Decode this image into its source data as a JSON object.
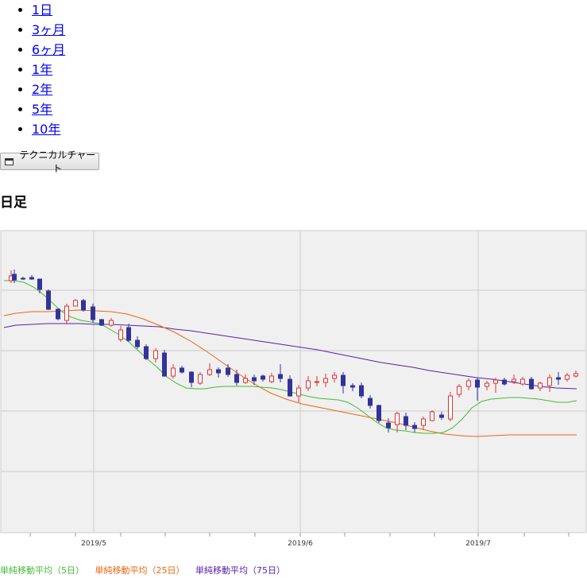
{
  "periods": [
    "1日",
    "3ヶ月",
    "6ヶ月",
    "1年",
    "2年",
    "5年",
    "10年"
  ],
  "tech_button_label": "テクニカルチャート",
  "title": "日足",
  "chart_data": {
    "type": "candlestick",
    "x_tick_labels": [
      "2019/5",
      "2019/6",
      "2019/7"
    ],
    "legend": [
      {
        "label": "単純移動平均（5日）",
        "color": "#44bb33"
      },
      {
        "label": "単純移動平均（25日）",
        "color": "#ee6611"
      },
      {
        "label": "単純移動平均（75日）",
        "color": "#5522aa"
      }
    ],
    "up_color": "#dd3333",
    "down_color": "#333399",
    "candles": [
      [
        14,
        65,
        59,
        68,
        52
      ],
      [
        18,
        57,
        64,
        68,
        51
      ],
      [
        29,
        62,
        63,
        64,
        60
      ],
      [
        40,
        61,
        63,
        64,
        58
      ],
      [
        50,
        63,
        76,
        81,
        63
      ],
      [
        61,
        78,
        101,
        102,
        76
      ],
      [
        73,
        101,
        113,
        115,
        100
      ],
      [
        84,
        115,
        97,
        120,
        94
      ],
      [
        95,
        97,
        90,
        96,
        88
      ],
      [
        105,
        90,
        102,
        104,
        88
      ],
      [
        117,
        98,
        114,
        118,
        94
      ],
      [
        128,
        114,
        121,
        122,
        113
      ],
      [
        140,
        121,
        115,
        123,
        112
      ],
      [
        152,
        139,
        127,
        142,
        122
      ],
      [
        162,
        124,
        140,
        142,
        119
      ],
      [
        173,
        140,
        148,
        151,
        135
      ],
      [
        184,
        148,
        163,
        165,
        145
      ],
      [
        196,
        163,
        153,
        168,
        150
      ],
      [
        207,
        156,
        185,
        186,
        152
      ],
      [
        218,
        185,
        175,
        188,
        170
      ],
      [
        229,
        175,
        180,
        182,
        172
      ],
      [
        241,
        180,
        193,
        199,
        179
      ],
      [
        252,
        194,
        183,
        196,
        180
      ],
      [
        264,
        183,
        177,
        185,
        169
      ],
      [
        275,
        177,
        181,
        187,
        174
      ],
      [
        287,
        175,
        183,
        186,
        170
      ],
      [
        298,
        183,
        193,
        197,
        177
      ],
      [
        309,
        193,
        188,
        195,
        183
      ],
      [
        320,
        187,
        191,
        196,
        183
      ],
      [
        331,
        185,
        189,
        192,
        183
      ],
      [
        342,
        192,
        185,
        194,
        181
      ],
      [
        353,
        183,
        188,
        193,
        170
      ],
      [
        365,
        189,
        210,
        211,
        184
      ],
      [
        376,
        210,
        200,
        218,
        196
      ],
      [
        388,
        200,
        191,
        204,
        185
      ],
      [
        399,
        193,
        192,
        198,
        185
      ],
      [
        410,
        193,
        188,
        199,
        182
      ],
      [
        421,
        188,
        184,
        193,
        180
      ],
      [
        432,
        184,
        197,
        207,
        180
      ],
      [
        444,
        197,
        199,
        204,
        194
      ],
      [
        455,
        197,
        210,
        213,
        193
      ],
      [
        466,
        213,
        222,
        226,
        209
      ],
      [
        477,
        222,
        241,
        244,
        221
      ],
      [
        489,
        244,
        250,
        256,
        238
      ],
      [
        500,
        246,
        232,
        256,
        230
      ],
      [
        511,
        236,
        247,
        253,
        231
      ],
      [
        522,
        247,
        251,
        256,
        243
      ],
      [
        533,
        247,
        239,
        252,
        236
      ],
      [
        544,
        241,
        230,
        242,
        228
      ],
      [
        556,
        234,
        237,
        240,
        230
      ],
      [
        567,
        239,
        210,
        242,
        205
      ],
      [
        578,
        208,
        198,
        212,
        195
      ],
      [
        590,
        198,
        191,
        203,
        188
      ],
      [
        601,
        190,
        199,
        216,
        187
      ],
      [
        613,
        198,
        194,
        203,
        191
      ],
      [
        624,
        194,
        190,
        206,
        187
      ],
      [
        635,
        190,
        195,
        197,
        187
      ],
      [
        647,
        192,
        189,
        195,
        183
      ],
      [
        658,
        195,
        189,
        197,
        186
      ],
      [
        669,
        189,
        201,
        202,
        186
      ],
      [
        680,
        200,
        194,
        204,
        192
      ],
      [
        692,
        197,
        187,
        205,
        183
      ],
      [
        703,
        187,
        189,
        196,
        180
      ],
      [
        714,
        189,
        184,
        192,
        181
      ],
      [
        725,
        185,
        182,
        187,
        178
      ]
    ],
    "ma5": [
      [
        5,
        65
      ],
      [
        18,
        65
      ],
      [
        30,
        67
      ],
      [
        42,
        73
      ],
      [
        54,
        82
      ],
      [
        66,
        93
      ],
      [
        78,
        104
      ],
      [
        90,
        111
      ],
      [
        102,
        115
      ],
      [
        114,
        117
      ],
      [
        126,
        119
      ],
      [
        138,
        126
      ],
      [
        150,
        133
      ],
      [
        162,
        142
      ],
      [
        174,
        153
      ],
      [
        186,
        164
      ],
      [
        198,
        174
      ],
      [
        210,
        186
      ],
      [
        222,
        194
      ],
      [
        234,
        200
      ],
      [
        246,
        201
      ],
      [
        258,
        201
      ],
      [
        270,
        199
      ],
      [
        282,
        198
      ],
      [
        294,
        198
      ],
      [
        306,
        198
      ],
      [
        318,
        198
      ],
      [
        330,
        199
      ],
      [
        342,
        200
      ],
      [
        354,
        202
      ],
      [
        366,
        205
      ],
      [
        378,
        208
      ],
      [
        390,
        211
      ],
      [
        402,
        213
      ],
      [
        414,
        214
      ],
      [
        426,
        215
      ],
      [
        438,
        218
      ],
      [
        450,
        225
      ],
      [
        462,
        234
      ],
      [
        474,
        243
      ],
      [
        486,
        250
      ],
      [
        498,
        253
      ],
      [
        510,
        254
      ],
      [
        522,
        256
      ],
      [
        534,
        257
      ],
      [
        546,
        257
      ],
      [
        558,
        256
      ],
      [
        570,
        250
      ],
      [
        582,
        239
      ],
      [
        594,
        225
      ],
      [
        606,
        217
      ],
      [
        618,
        214
      ],
      [
        630,
        213
      ],
      [
        642,
        212
      ],
      [
        654,
        212
      ],
      [
        666,
        213
      ],
      [
        678,
        214
      ],
      [
        690,
        216
      ],
      [
        702,
        218
      ],
      [
        714,
        218
      ],
      [
        726,
        216
      ]
    ],
    "ma25": [
      [
        5,
        109
      ],
      [
        20,
        106
      ],
      [
        40,
        104
      ],
      [
        60,
        104
      ],
      [
        80,
        103
      ],
      [
        100,
        102
      ],
      [
        120,
        103
      ],
      [
        140,
        104
      ],
      [
        160,
        107
      ],
      [
        180,
        113
      ],
      [
        200,
        121
      ],
      [
        220,
        130
      ],
      [
        240,
        141
      ],
      [
        260,
        154
      ],
      [
        280,
        168
      ],
      [
        300,
        182
      ],
      [
        320,
        195
      ],
      [
        340,
        206
      ],
      [
        360,
        214
      ],
      [
        380,
        220
      ],
      [
        400,
        224
      ],
      [
        420,
        228
      ],
      [
        440,
        232
      ],
      [
        460,
        236
      ],
      [
        480,
        240
      ],
      [
        500,
        244
      ],
      [
        520,
        249
      ],
      [
        540,
        254
      ],
      [
        560,
        258
      ],
      [
        580,
        260
      ],
      [
        600,
        261
      ],
      [
        620,
        260
      ],
      [
        640,
        259
      ],
      [
        660,
        259
      ],
      [
        680,
        259
      ],
      [
        700,
        259
      ],
      [
        726,
        259
      ]
    ],
    "ma75": [
      [
        5,
        124
      ],
      [
        20,
        121
      ],
      [
        40,
        120
      ],
      [
        60,
        119
      ],
      [
        80,
        119
      ],
      [
        100,
        119
      ],
      [
        120,
        120
      ],
      [
        140,
        120
      ],
      [
        160,
        121
      ],
      [
        180,
        122
      ],
      [
        200,
        123
      ],
      [
        220,
        126
      ],
      [
        240,
        128
      ],
      [
        260,
        131
      ],
      [
        280,
        134
      ],
      [
        300,
        137
      ],
      [
        320,
        140
      ],
      [
        340,
        143
      ],
      [
        360,
        146
      ],
      [
        380,
        149
      ],
      [
        400,
        152
      ],
      [
        420,
        156
      ],
      [
        440,
        160
      ],
      [
        460,
        164
      ],
      [
        480,
        168
      ],
      [
        500,
        171
      ],
      [
        520,
        174
      ],
      [
        540,
        178
      ],
      [
        560,
        181
      ],
      [
        580,
        184
      ],
      [
        600,
        187
      ],
      [
        620,
        189
      ],
      [
        640,
        192
      ],
      [
        660,
        195
      ],
      [
        680,
        198
      ],
      [
        700,
        200
      ],
      [
        726,
        201
      ]
    ]
  }
}
